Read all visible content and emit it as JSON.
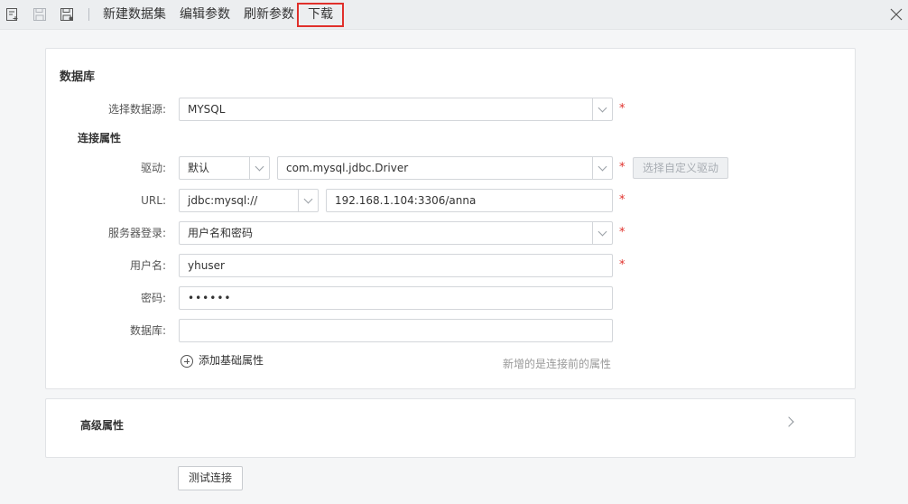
{
  "toolbar": {
    "new_dataset": "新建数据集",
    "edit_params": "编辑参数",
    "refresh_params": "刷新参数",
    "download": "下载"
  },
  "database_section": {
    "title": "数据库",
    "datasource_label": "选择数据源:",
    "datasource_value": "MYSQL",
    "connection_title": "连接属性",
    "driver_label": "驱动:",
    "driver_mode": "默认",
    "driver_class": "com.mysql.jdbc.Driver",
    "custom_driver_button": "选择自定义驱动",
    "url_label": "URL:",
    "url_prefix": "jdbc:mysql://",
    "url_value": "192.168.1.104:3306/anna",
    "login_label": "服务器登录:",
    "login_value": "用户名和密码",
    "username_label": "用户名:",
    "username_value": "yhuser",
    "password_label": "密码:",
    "password_value": "••••••",
    "database_label": "数据库:",
    "database_value": "",
    "add_property": "添加基础属性",
    "hint": "新增的是连接前的属性",
    "required_mark": "*"
  },
  "advanced_section": {
    "title": "高级属性"
  },
  "test_connection": "测试连接",
  "colors": {
    "accent_red": "#e0302b",
    "toolbar_bg": "#eceef0",
    "page_bg": "#f5f6f7"
  },
  "icons": [
    "new-dataset-icon",
    "save-icon",
    "save-as-icon",
    "close-icon",
    "chevron-down-icon",
    "chevron-right-icon",
    "plus-circle-icon"
  ]
}
